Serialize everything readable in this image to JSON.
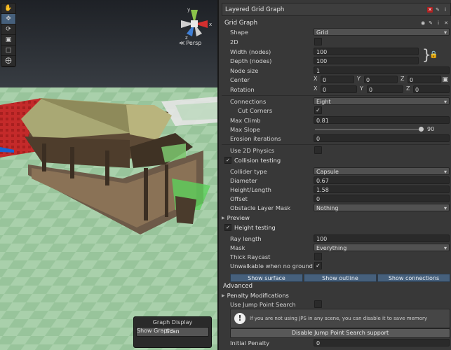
{
  "scene": {
    "tools": [
      "hand-tool-icon",
      "move-tool-icon",
      "rotate-tool-icon",
      "scale-tool-icon",
      "rect-tool-icon",
      "transform-tool-icon"
    ],
    "gizmo_axes": {
      "x": "x",
      "y": "y",
      "z": "z"
    },
    "projection_label": "Persp",
    "graph_display": {
      "title": "Graph Display",
      "show_graphs_label": "Show Graphs",
      "show_graphs_checked": "✓",
      "scan_label": "Scan"
    }
  },
  "inspector": {
    "component_title": "Layered Grid Graph",
    "graph_title": "Grid Graph",
    "check_mark": "✓",
    "fields": {
      "shape": {
        "label": "Shape",
        "value": "Grid"
      },
      "is2d": {
        "label": "2D"
      },
      "width": {
        "label": "Width (nodes)",
        "value": "100"
      },
      "depth": {
        "label": "Depth (nodes)",
        "value": "100"
      },
      "node_size": {
        "label": "Node size",
        "value": "1"
      },
      "center": {
        "label": "Center",
        "x": "0",
        "y": "0",
        "z": "0"
      },
      "rotation": {
        "label": "Rotation",
        "x": "0",
        "y": "0",
        "z": "0"
      },
      "connections": {
        "label": "Connections",
        "value": "Eight"
      },
      "cut_corners": {
        "label": "Cut Corners"
      },
      "max_climb": {
        "label": "Max Climb",
        "value": "0.81"
      },
      "max_slope": {
        "label": "Max Slope",
        "value": "90",
        "fraction": 1.0
      },
      "erosion": {
        "label": "Erosion iterations",
        "value": "0"
      },
      "use_2d_physics": {
        "label": "Use 2D Physics"
      },
      "collision_testing": {
        "label": "Collision testing"
      },
      "collider_type": {
        "label": "Collider type",
        "value": "Capsule"
      },
      "diameter": {
        "label": "Diameter",
        "value": "0.67"
      },
      "height_length": {
        "label": "Height/Length",
        "value": "1.58"
      },
      "offset": {
        "label": "Offset",
        "value": "0"
      },
      "obstacle_layer_mask": {
        "label": "Obstacle Layer Mask",
        "value": "Nothing"
      },
      "preview": {
        "label": "Preview"
      },
      "height_testing": {
        "label": "Height testing"
      },
      "ray_length": {
        "label": "Ray length",
        "value": "100"
      },
      "mask": {
        "label": "Mask",
        "value": "Everything"
      },
      "thick_raycast": {
        "label": "Thick Raycast"
      },
      "unwalkable_no_ground": {
        "label": "Unwalkable when no ground"
      }
    },
    "axis_labels": {
      "x": "X",
      "y": "Y",
      "z": "Z"
    },
    "toggle_buttons": [
      "Show surface",
      "Show outline",
      "Show connections"
    ],
    "advanced": {
      "title": "Advanced",
      "penalty_modifications": "Penalty Modifications",
      "use_jps": "Use Jump Point Search",
      "jps_help": "If you are not using JPS in any scene, you can disable it to save memory",
      "disable_jps_button": "Disable Jump Point Search support",
      "initial_penalty": {
        "label": "Initial Penalty",
        "value": "0"
      }
    }
  }
}
